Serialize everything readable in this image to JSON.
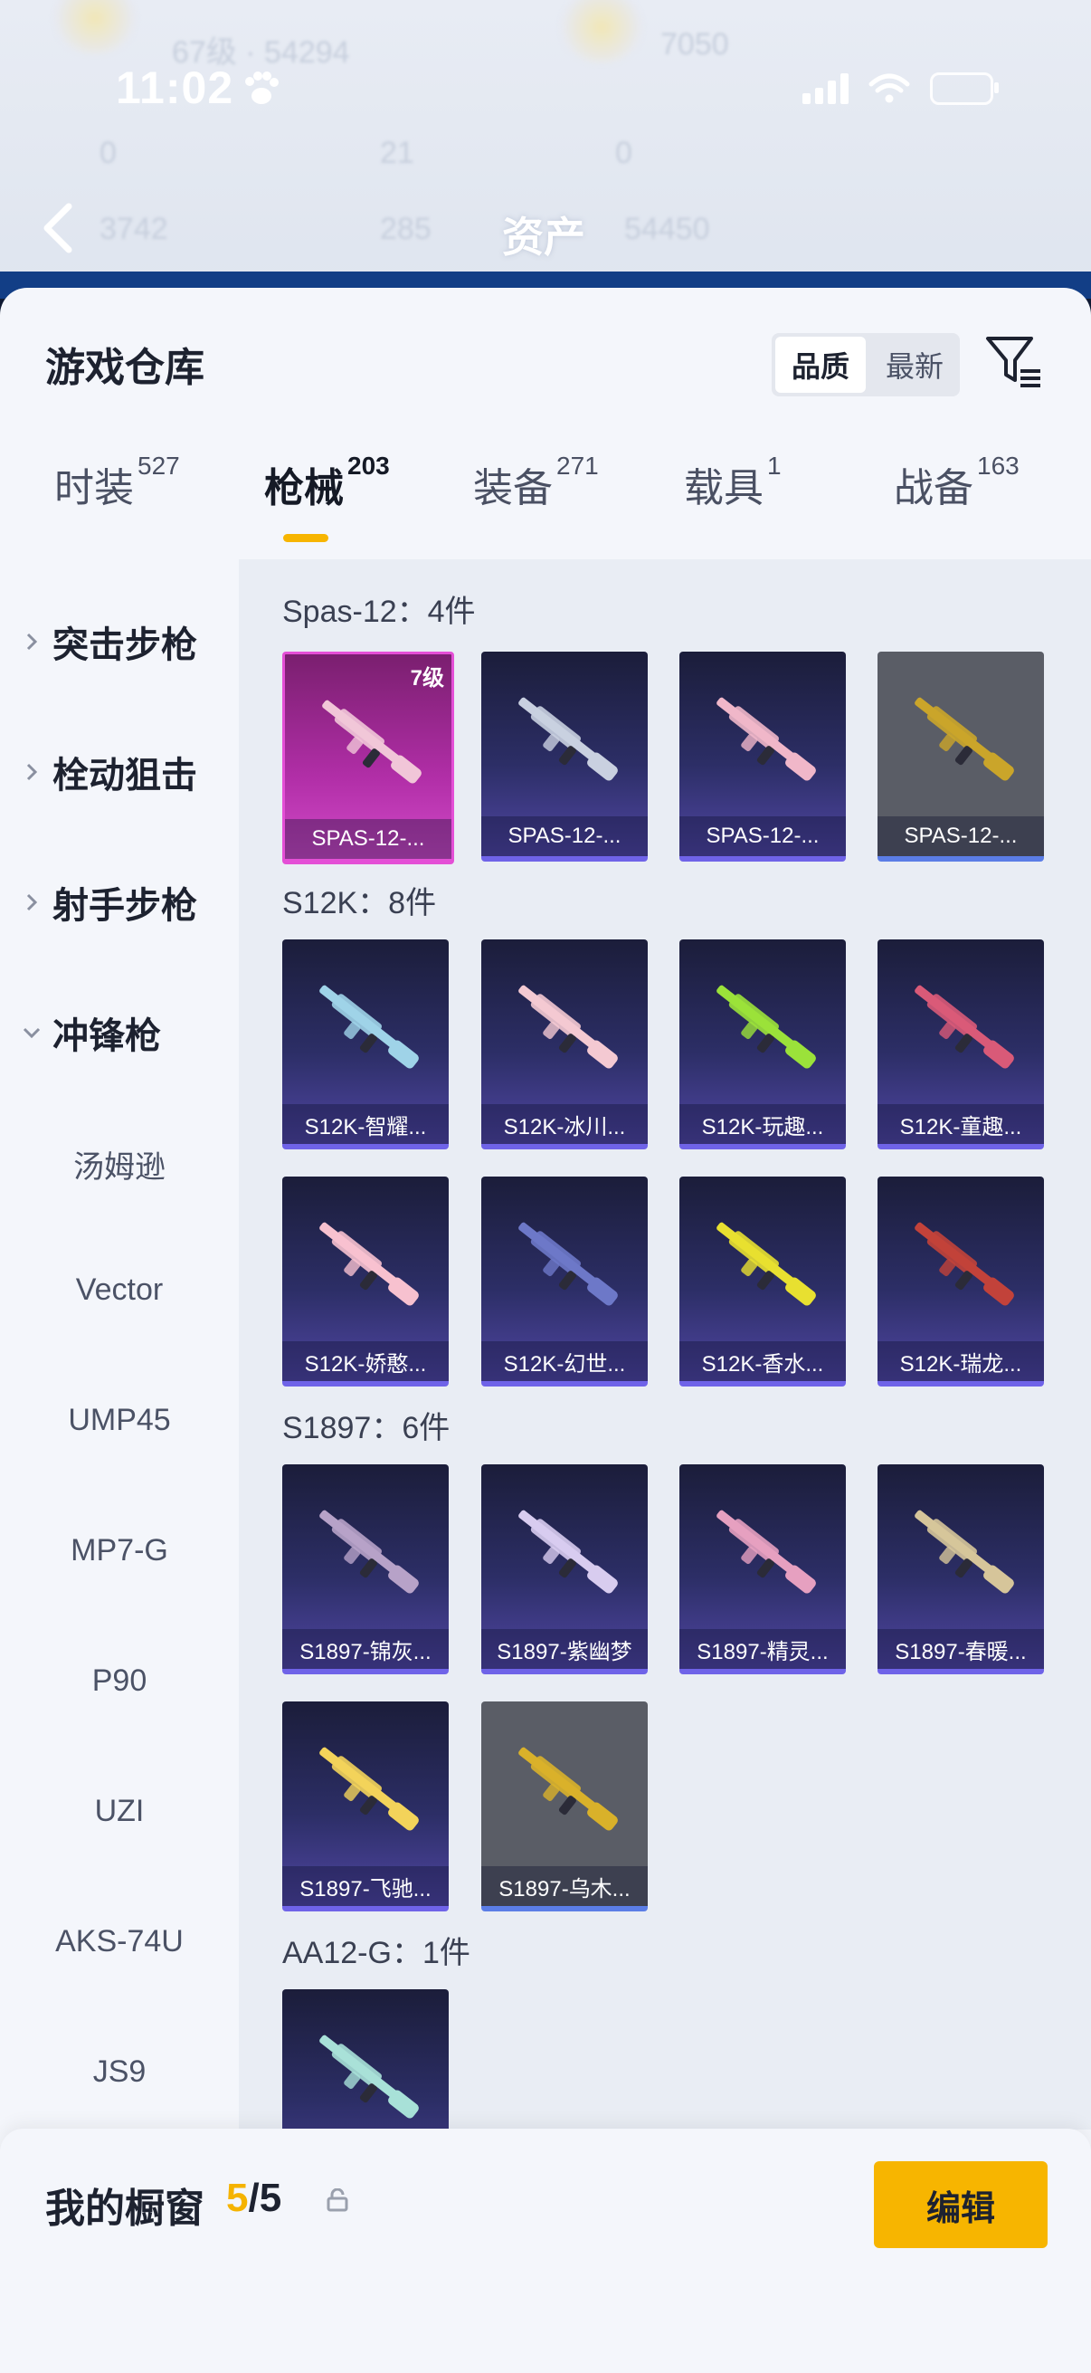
{
  "status_bar": {
    "time": "11:02"
  },
  "header": {
    "title": "资产"
  },
  "sheet": {
    "title": "游戏仓库",
    "sort_options": [
      {
        "label": "品质",
        "active": true
      },
      {
        "label": "最新",
        "active": false
      }
    ]
  },
  "category_tabs": [
    {
      "label": "时装",
      "count": "527"
    },
    {
      "label": "枪械",
      "count": "203",
      "active": true
    },
    {
      "label": "装备",
      "count": "271"
    },
    {
      "label": "载具",
      "count": "1"
    },
    {
      "label": "战备",
      "count": "163"
    }
  ],
  "side_nav": {
    "groups": [
      {
        "label": "突击步枪",
        "expanded": false
      },
      {
        "label": "栓动狙击",
        "expanded": false
      },
      {
        "label": "射手步枪",
        "expanded": false
      },
      {
        "label": "冲锋枪",
        "expanded": true
      }
    ],
    "sub_items": [
      "汤姆逊",
      "Vector",
      "UMP45",
      "MP7-G",
      "P90",
      "UZI",
      "AKS-74U",
      "JS9"
    ]
  },
  "sections": [
    {
      "title": "Spas-12：4件",
      "items": [
        {
          "label": "SPAS-12-...",
          "style": "pink",
          "level": "7级",
          "gun_color": "#f1c6d8"
        },
        {
          "label": "SPAS-12-...",
          "style": "purple",
          "gun_color": "#c9d0e0"
        },
        {
          "label": "SPAS-12-...",
          "style": "purple",
          "gun_color": "#f0b7c9"
        },
        {
          "label": "SPAS-12-...",
          "style": "gray",
          "gun_color": "#caa52a"
        }
      ]
    },
    {
      "title": "S12K：8件",
      "items": [
        {
          "label": "S12K-智耀...",
          "style": "purple",
          "gun_color": "#9fd3e8"
        },
        {
          "label": "S12K-冰川...",
          "style": "purple",
          "gun_color": "#f4c9d2"
        },
        {
          "label": "S12K-玩趣...",
          "style": "purple",
          "gun_color": "#9be23a"
        },
        {
          "label": "S12K-童趣...",
          "style": "purple",
          "gun_color": "#d95a78"
        },
        {
          "label": "S12K-娇憨...",
          "style": "purple",
          "gun_color": "#f7c1cf"
        },
        {
          "label": "S12K-幻世...",
          "style": "purple",
          "gun_color": "#6d78c8"
        },
        {
          "label": "S12K-香水...",
          "style": "purple",
          "gun_color": "#e8e030"
        },
        {
          "label": "S12K-瑞龙...",
          "style": "purple",
          "gun_color": "#c2423a"
        }
      ]
    },
    {
      "title": "S1897：6件",
      "items": [
        {
          "label": "S1897-锦灰...",
          "style": "purple",
          "gun_color": "#b7a2c8"
        },
        {
          "label": "S1897-紫幽梦",
          "style": "purple",
          "gun_color": "#d8ccef"
        },
        {
          "label": "S1897-精灵...",
          "style": "purple",
          "gun_color": "#e6a0c0"
        },
        {
          "label": "S1897-春暖...",
          "style": "purple",
          "gun_color": "#d6c59a"
        },
        {
          "label": "S1897-飞驰...",
          "style": "purple",
          "gun_color": "#f3d35a"
        },
        {
          "label": "S1897-乌木...",
          "style": "gray",
          "gun_color": "#d9b12a"
        }
      ]
    },
    {
      "title": "AA12-G：1件",
      "items": [
        {
          "label": "",
          "style": "purple",
          "gun_color": "#a8e1d8"
        }
      ]
    }
  ],
  "bottom_bar": {
    "label": "我的橱窗",
    "count_current": "5",
    "count_total": "/5",
    "edit_label": "编辑"
  },
  "colors": {
    "accent": "#f7b500",
    "header_band": "#123e86"
  }
}
